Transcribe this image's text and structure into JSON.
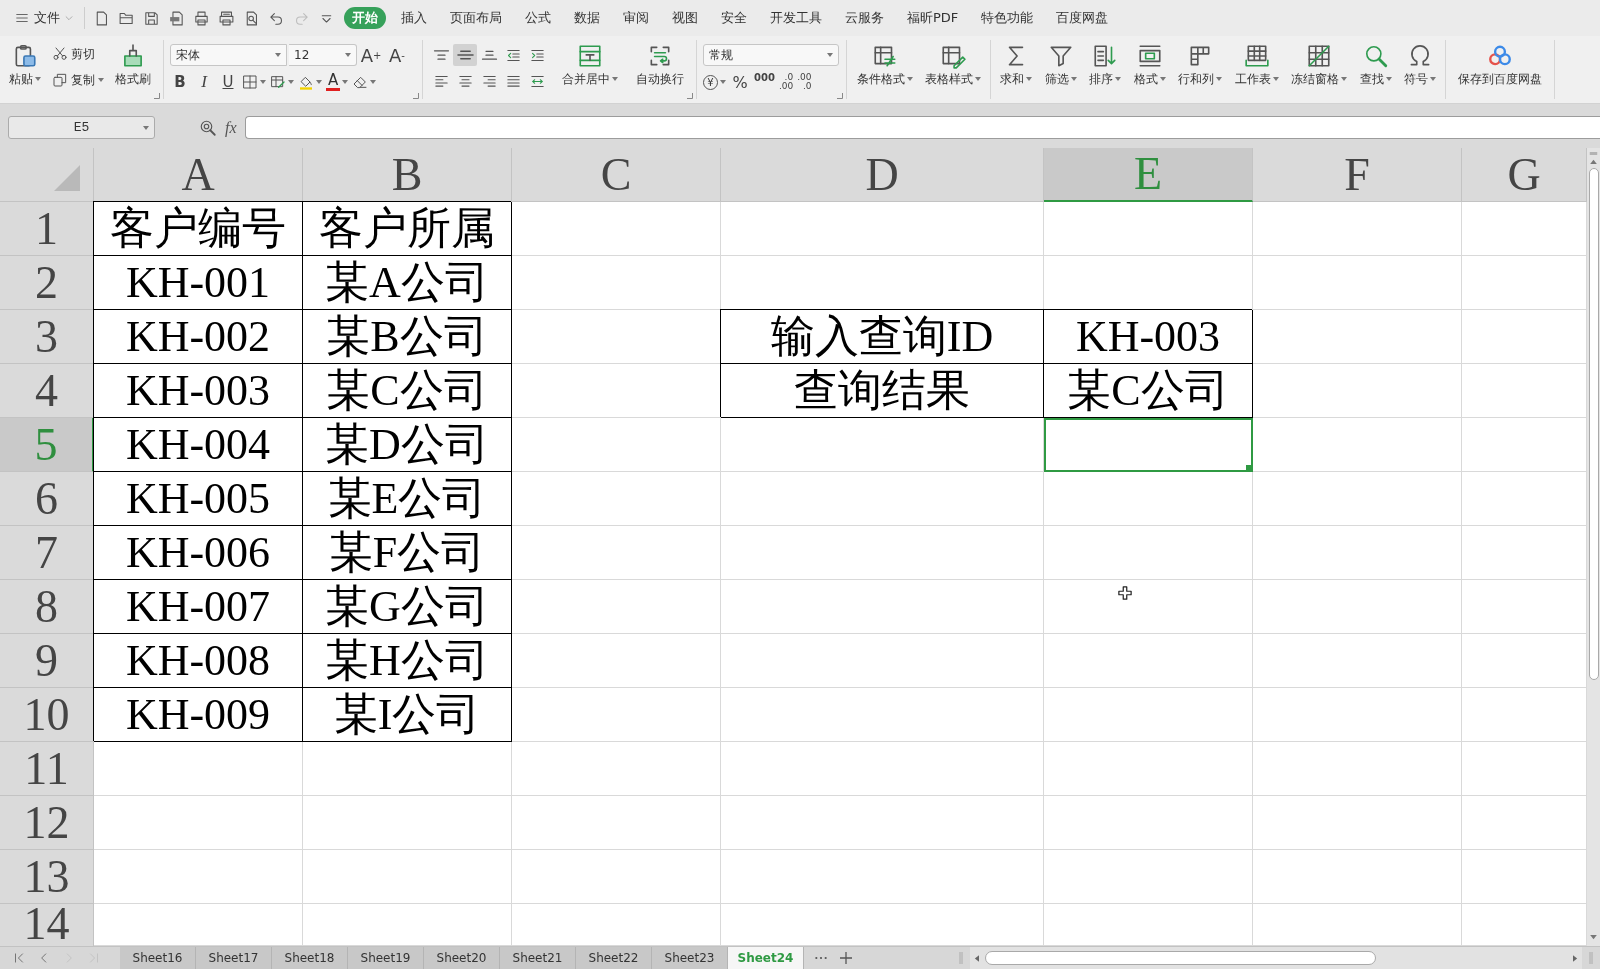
{
  "menu_bar": {
    "file_menu": "文件",
    "quick_access": [
      {
        "kind": "new",
        "disabled": false
      },
      {
        "kind": "open",
        "disabled": false
      },
      {
        "kind": "save",
        "disabled": false
      },
      {
        "kind": "pdf",
        "disabled": false
      },
      {
        "kind": "print",
        "disabled": false
      },
      {
        "kind": "print-setup",
        "disabled": false
      },
      {
        "kind": "preview",
        "disabled": false
      },
      {
        "kind": "undo",
        "disabled": false
      },
      {
        "kind": "redo",
        "disabled": true
      },
      {
        "kind": "customize",
        "disabled": false
      }
    ],
    "tabs": [
      {
        "label": "开始",
        "selected": true
      },
      {
        "label": "插入",
        "selected": false
      },
      {
        "label": "页面布局",
        "selected": false
      },
      {
        "label": "公式",
        "selected": false
      },
      {
        "label": "数据",
        "selected": false
      },
      {
        "label": "审阅",
        "selected": false
      },
      {
        "label": "视图",
        "selected": false
      },
      {
        "label": "安全",
        "selected": false
      },
      {
        "label": "开发工具",
        "selected": false
      },
      {
        "label": "云服务",
        "selected": false
      },
      {
        "label": "福昕PDF",
        "selected": false
      },
      {
        "label": "特色功能",
        "selected": false
      },
      {
        "label": "百度网盘",
        "selected": false
      }
    ]
  },
  "ribbon": {
    "clipboard": {
      "paste": "粘贴",
      "cut": "剪切",
      "copy": "复制",
      "format_painter": "格式刷"
    },
    "font": {
      "name": "宋体",
      "size": "12",
      "grow": "A$^{+}$",
      "shrink": "A$^{-}$",
      "bold": "B",
      "italic": "I",
      "underline": "U",
      "font_color": "A"
    },
    "alignment": {
      "buttons": [
        {
          "kind": "top",
          "selected": false
        },
        {
          "kind": "middle",
          "selected": true
        },
        {
          "kind": "bottom",
          "selected": false
        },
        {
          "kind": "outdent",
          "selected": false
        },
        {
          "kind": "indent",
          "selected": false
        },
        {
          "kind": "left",
          "selected": false
        },
        {
          "kind": "center",
          "selected": false
        },
        {
          "kind": "right",
          "selected": false
        },
        {
          "kind": "justify",
          "selected": false
        },
        {
          "kind": "distributed",
          "selected": false
        }
      ],
      "merge": "合并居中",
      "wrap": "自动换行"
    },
    "number": {
      "format": "常规",
      "currency": "¥",
      "percent": "%",
      "thousands": "000",
      "increase_decimal": [
        ".0",
        ".00"
      ],
      "decrease_decimal": [
        ".00",
        ".0"
      ]
    },
    "styles": [
      {
        "kind": "conditional-format",
        "label": "条件格式"
      },
      {
        "kind": "table-style",
        "label": "表格样式"
      }
    ],
    "tools": [
      {
        "kind": "sum",
        "label": "求和"
      },
      {
        "kind": "filter",
        "label": "筛选"
      },
      {
        "kind": "sort",
        "label": "排序"
      },
      {
        "kind": "format",
        "label": "格式"
      },
      {
        "kind": "rows-columns",
        "label": "行和列"
      },
      {
        "kind": "worksheet",
        "label": "工作表"
      },
      {
        "kind": "freeze",
        "label": "冻结窗格"
      },
      {
        "kind": "find",
        "label": "查找"
      },
      {
        "kind": "symbol",
        "label": "符号"
      }
    ],
    "cloud_save": "保存到百度网盘"
  },
  "formula_bar": {
    "name_box": "E5",
    "fx": "fx"
  },
  "sheet": {
    "columns": [
      {
        "label": "A",
        "selected": false
      },
      {
        "label": "B",
        "selected": false
      },
      {
        "label": "C",
        "selected": false
      },
      {
        "label": "D",
        "selected": false
      },
      {
        "label": "E",
        "selected": true
      },
      {
        "label": "F",
        "selected": false
      },
      {
        "label": "G",
        "selected": false
      }
    ],
    "rows": [
      {
        "label": "1",
        "selected": false
      },
      {
        "label": "2",
        "selected": false
      },
      {
        "label": "3",
        "selected": false
      },
      {
        "label": "4",
        "selected": false
      },
      {
        "label": "5",
        "selected": true
      },
      {
        "label": "6",
        "selected": false
      },
      {
        "label": "7",
        "selected": false
      },
      {
        "label": "8",
        "selected": false
      },
      {
        "label": "9",
        "selected": false
      },
      {
        "label": "10",
        "selected": false
      },
      {
        "label": "11",
        "selected": false
      },
      {
        "label": "12",
        "selected": false
      },
      {
        "label": "13",
        "selected": false
      },
      {
        "label": "14",
        "selected": false
      }
    ]
  },
  "customer_table": {
    "header": [
      "客户编号",
      "客户所属"
    ],
    "rows": [
      [
        "KH-001",
        "某A公司"
      ],
      [
        "KH-002",
        "某B公司"
      ],
      [
        "KH-003",
        "某C公司"
      ],
      [
        "KH-004",
        "某D公司"
      ],
      [
        "KH-005",
        "某E公司"
      ],
      [
        "KH-006",
        "某F公司"
      ],
      [
        "KH-007",
        "某G公司"
      ],
      [
        "KH-008",
        "某H公司"
      ],
      [
        "KH-009",
        "某I公司"
      ]
    ]
  },
  "lookup": [
    {
      "label": "输入查询ID",
      "value": "KH-003"
    },
    {
      "label": "查询结果",
      "value": "某C公司"
    }
  ],
  "sheet_tabs": {
    "nav": [
      {
        "kind": "first",
        "disabled": false
      },
      {
        "kind": "previous",
        "disabled": false
      },
      {
        "kind": "next",
        "disabled": true
      },
      {
        "kind": "last",
        "disabled": true
      }
    ],
    "tabs": [
      {
        "label": "Sheet16",
        "selected": false
      },
      {
        "label": "Sheet17",
        "selected": false
      },
      {
        "label": "Sheet18",
        "selected": false
      },
      {
        "label": "Sheet19",
        "selected": false
      },
      {
        "label": "Sheet20",
        "selected": false
      },
      {
        "label": "Sheet21",
        "selected": false
      },
      {
        "label": "Sheet22",
        "selected": false
      },
      {
        "label": "Sheet23",
        "selected": false
      },
      {
        "label": "Sheet24",
        "selected": true
      }
    ]
  }
}
